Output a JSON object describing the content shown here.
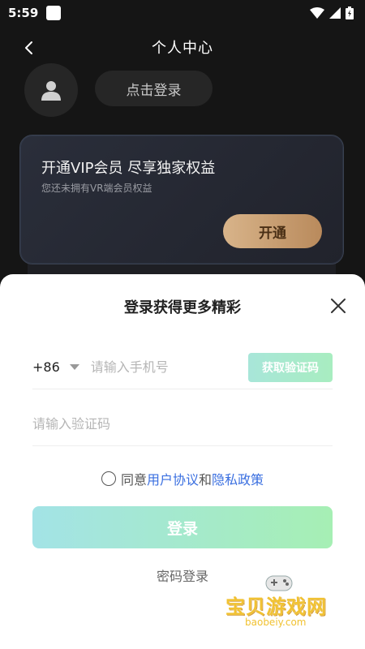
{
  "status_bar": {
    "time": "5:59"
  },
  "header": {
    "title": "个人中心"
  },
  "profile": {
    "login_label": "点击登录"
  },
  "vip_card": {
    "title": "开通VIP会员 尽享独家权益",
    "subtitle": "您还未拥有VR端会员权益",
    "open_label": "开通"
  },
  "login_sheet": {
    "title": "登录获得更多精彩",
    "country_code": "+86",
    "phone_placeholder": "请输入手机号",
    "get_code_label": "获取验证码",
    "code_placeholder": "请输入验证码",
    "agree_prefix": "同意",
    "user_agreement": "用户协议",
    "agree_and": "和",
    "privacy_policy": "隐私政策",
    "login_label": "登录",
    "password_login": "密码登录"
  },
  "watermark": {
    "text": "宝贝游戏网",
    "domain": "baobeiy.com"
  },
  "colors": {
    "accent_green": "#a6efb4",
    "link_blue": "#3a6fe0",
    "vip_gold": "#d8b48a"
  }
}
